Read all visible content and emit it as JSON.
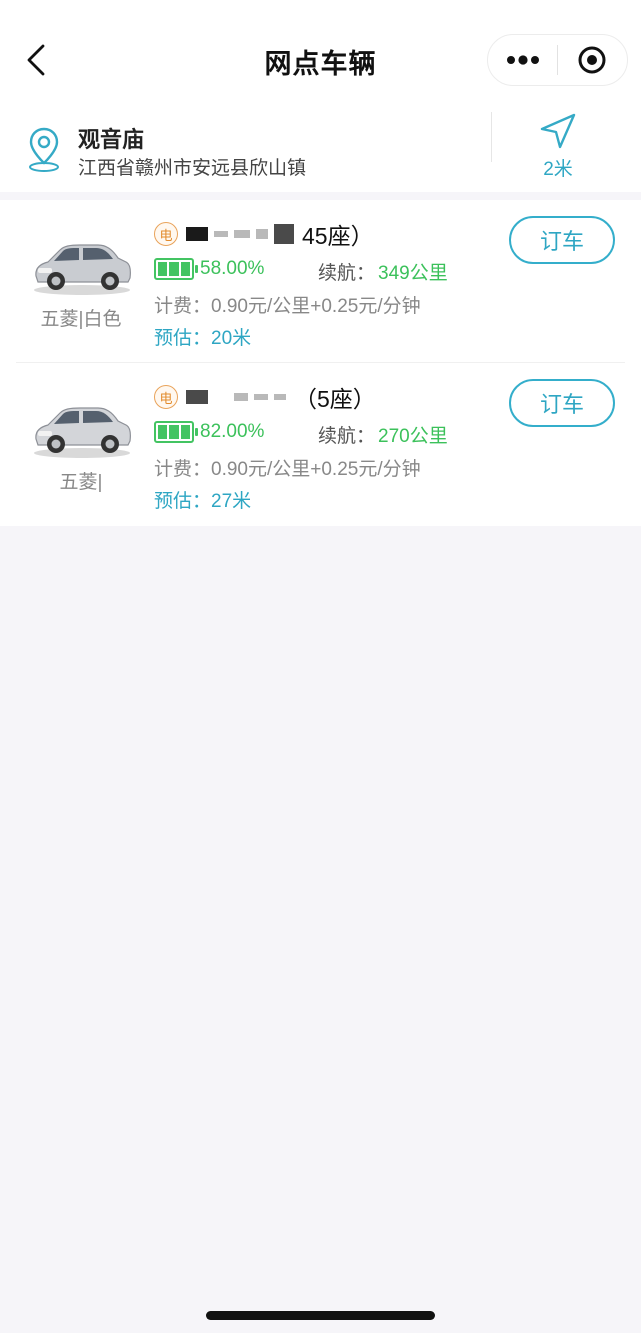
{
  "header": {
    "title": "网点车辆"
  },
  "location": {
    "name": "观音庙",
    "address": "江西省赣州市安远县欣山镇",
    "distance": "2米"
  },
  "cars": [
    {
      "badge": "电",
      "seats": "45座）",
      "battery": "58.00%",
      "battery_level": 0.58,
      "range_label": "续航：",
      "range_value": "349公里",
      "fee": "计费：0.90元/公里+0.25元/分钟",
      "eta": "预估：20米",
      "brand": "五菱|白色",
      "order_label": "订车"
    },
    {
      "badge": "电",
      "seats": "（5座）",
      "battery": "82.00%",
      "battery_level": 0.82,
      "range_label": "续航：",
      "range_value": "270公里",
      "fee": "计费：0.90元/公里+0.25元/分钟",
      "eta": "预估：27米",
      "brand": "五菱|",
      "order_label": "订车"
    }
  ],
  "icons": {
    "back": "chevron-left-icon",
    "more": "more-dots-icon",
    "close": "target-circle-icon",
    "location": "location-pin-icon",
    "navigate": "navigation-arrow-icon",
    "car": "car-icon",
    "battery": "battery-icon"
  },
  "colors": {
    "accent": "#2ea6c3",
    "battery_green": "#3cc15b",
    "badge_orange": "#e28b2d"
  }
}
